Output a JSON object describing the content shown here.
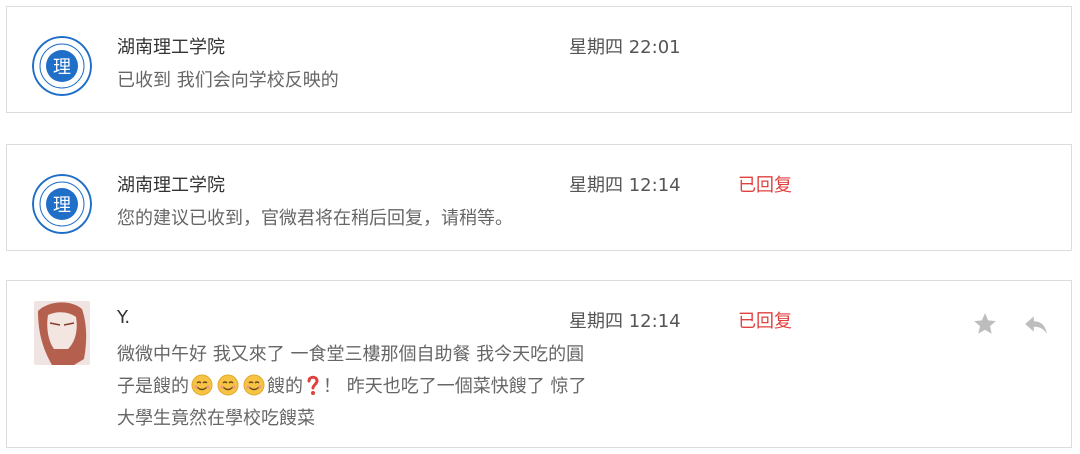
{
  "messages": [
    {
      "sender": "湖南理工学院",
      "time": "星期四 22:01",
      "status": "",
      "preview": "已收到 我们会向学校反映的"
    },
    {
      "sender": "湖南理工学院",
      "time": "星期四 12:14",
      "status": "已回复",
      "preview": "您的建议已收到，官微君将在稍后回复，请稍等。"
    },
    {
      "sender": "Y.",
      "time": "星期四 12:14",
      "status": "已回复",
      "preview_part1": "微微中午好 我又來了 一食堂三樓那個自助餐 我今天吃的圓子是餿的",
      "preview_part2": "餿的",
      "preview_part3": "！ 昨天也吃了一個菜快餿了 惊了 大學生竟然在學校吃餿菜"
    }
  ],
  "logo": {
    "char": "理"
  },
  "colors": {
    "status": "#e0413f",
    "logo_blue": "#1f6fc8",
    "icon_gray": "#bdbdbd"
  },
  "icons": [
    "star-icon",
    "reply-icon"
  ]
}
